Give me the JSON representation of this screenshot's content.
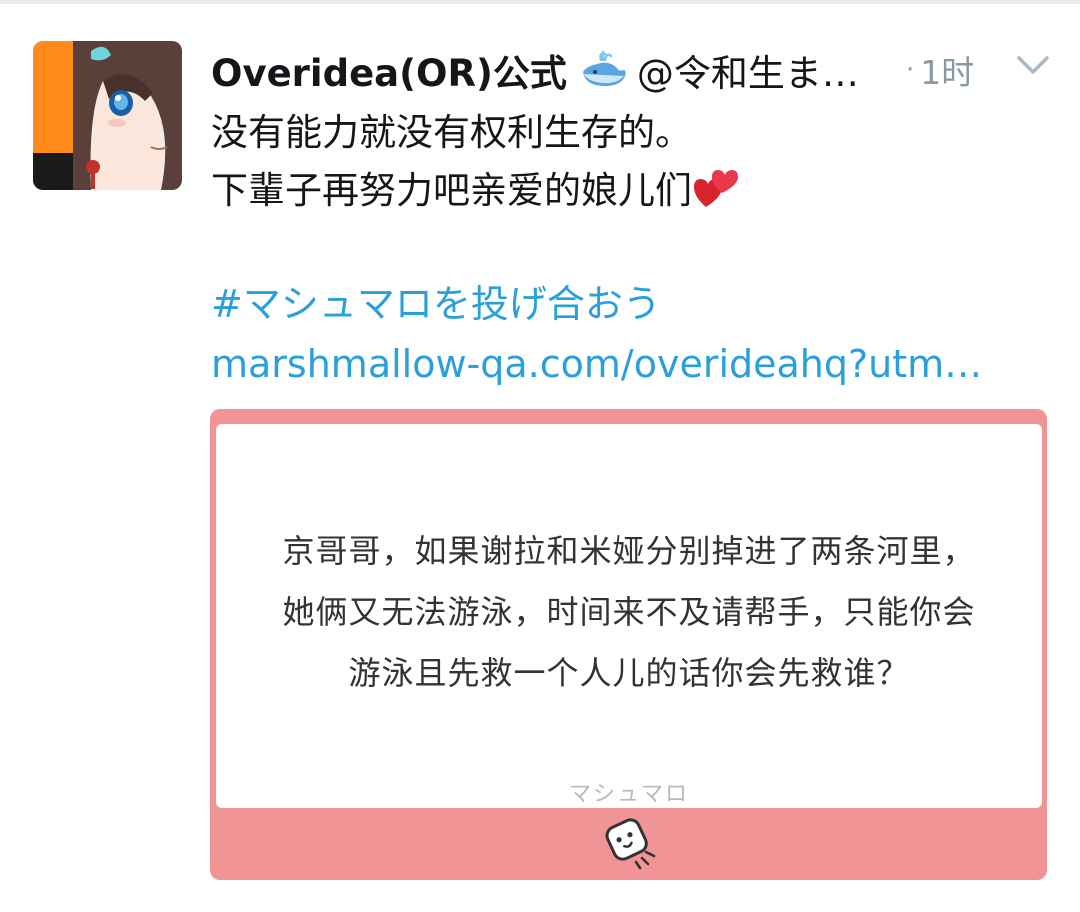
{
  "tweet": {
    "display_name": "Overidea(OR)公式",
    "handle": "@令和生ま…",
    "timestamp": "1时",
    "text_lines": [
      "没有能力就没有权利生存的。",
      "下輩子再努力吧亲爱的娘儿们"
    ],
    "hashtag": "#マシュマロを投げ合おう",
    "link": "marshmallow-qa.com/overideahq?utm…",
    "icons": [
      "whale-icon",
      "heart-icon",
      "chevron-down-icon",
      "marshmallow-icon"
    ]
  },
  "card": {
    "question_lines": [
      "京哥哥，如果谢拉和米娅分别掉进了两条河里，",
      "她俩又无法游泳，时间来不及请帮手，只能你会",
      "游泳且先救一个人儿的话你会先救谁？"
    ],
    "brand": "マシュマロ",
    "colors": {
      "card_frame": "#f09496",
      "link": "#2b9fd9",
      "meta": "#8899a6"
    }
  }
}
